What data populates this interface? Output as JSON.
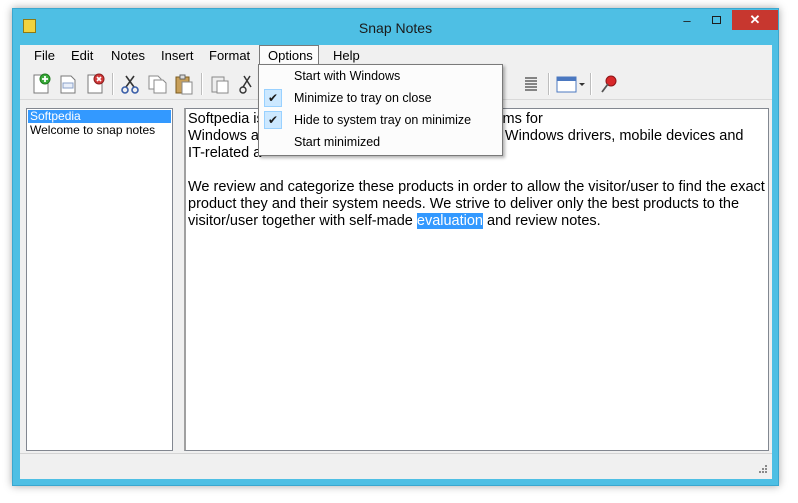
{
  "window": {
    "title": "Snap Notes",
    "minimize_glyph": "–",
    "close_glyph": "✕"
  },
  "menubar": [
    "File",
    "Edit",
    "Notes",
    "Insert",
    "Format",
    "Options",
    "Help"
  ],
  "options_menu": {
    "items": [
      {
        "label": "Start with Windows",
        "checked": false
      },
      {
        "label": "Minimize to tray on close",
        "checked": true
      },
      {
        "label": "Hide to system tray on minimize",
        "checked": true
      },
      {
        "label": "Start minimized",
        "checked": false
      }
    ],
    "check_glyph": "✔"
  },
  "toolbar": {
    "icons": [
      "new-note-icon",
      "rename-note-icon",
      "delete-note-icon",
      "cut-icon",
      "copy-icon",
      "paste-icon",
      "paste-special-icon",
      "scissors-icon",
      "align-justify-icon",
      "calendar-dropdown-icon",
      "pin-icon"
    ]
  },
  "notes": [
    {
      "title": "Softpedia",
      "selected": true
    },
    {
      "title": "Welcome to snap notes",
      "selected": false
    }
  ],
  "editor": {
    "line1_a": "Softpedia is",
    "line1_b": "ee-to-try software programs for",
    "line2_a": "Windows a",
    "line2_b": "Windows drivers, mobile devices and",
    "line3_a": "IT-related a",
    "p2_pre": "We review and categorize these products in order to allow the visitor/user to find the exact product they and their system needs. We strive to deliver only the best products to the visitor/user together with self-made ",
    "p2_highlight": "evaluation",
    "p2_post": " and review notes."
  },
  "colors": {
    "frame": "#4ebfe4",
    "close_button": "#c7372f",
    "selection": "#3399ff"
  }
}
